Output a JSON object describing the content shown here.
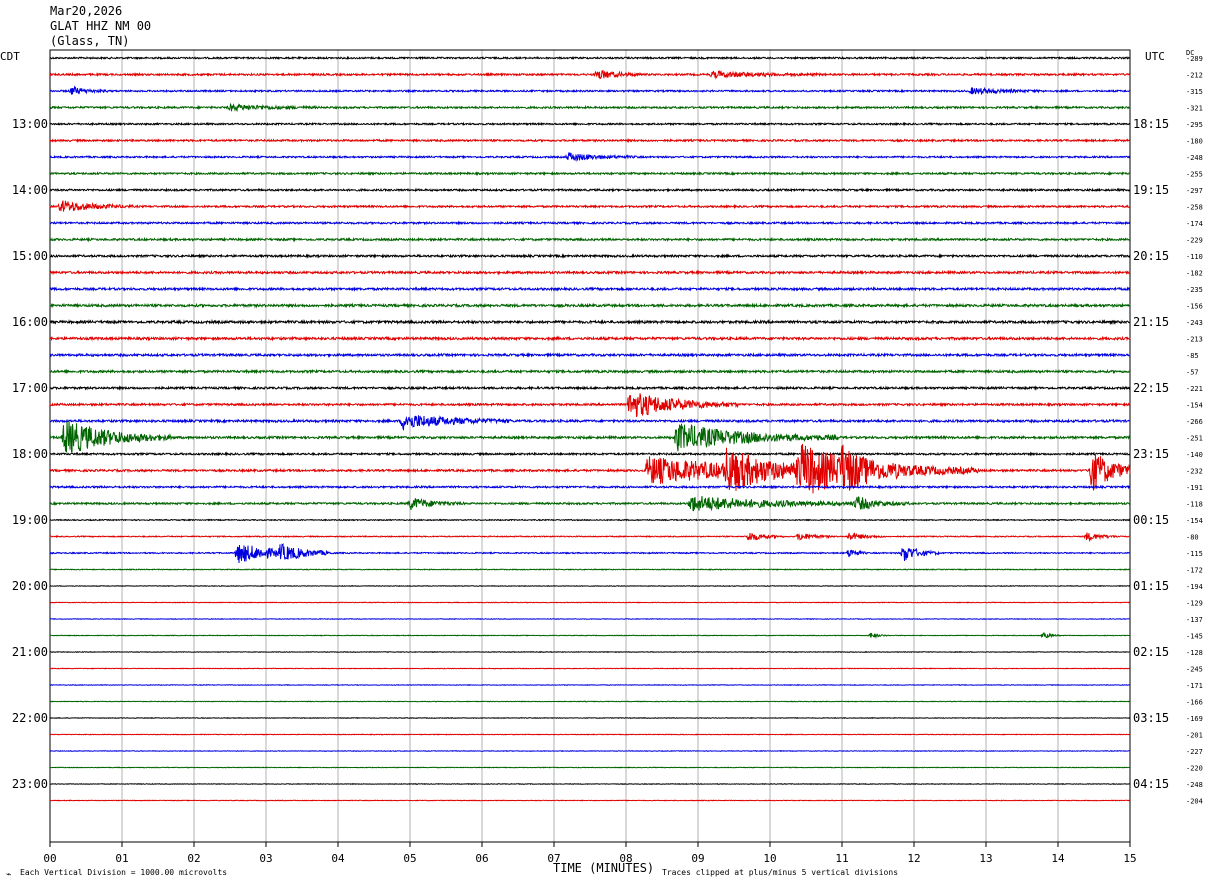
{
  "header": {
    "date": "Mar20,2026",
    "station": "GLAT HHZ NM 00",
    "location": "(Glass, TN)"
  },
  "left_axis_label": "CDT",
  "right_axis_label": "UTC",
  "dc_label": "DC",
  "footer": {
    "scale_note": "Each Vertical Division = 1000.00 microvolts",
    "xlabel": "TIME (MINUTES)",
    "clip_note": "Traces clipped at plus/minus 5 vertical divisions"
  },
  "colors": {
    "cycle": [
      "#000000",
      "#e00000",
      "#0000e0",
      "#006400"
    ],
    "grid": "#808080"
  },
  "chart_data": {
    "type": "line",
    "title": "GLAT HHZ NM 00",
    "xlabel": "TIME (MINUTES)",
    "xlim": [
      0,
      15
    ],
    "x_ticks": [
      "00",
      "01",
      "02",
      "03",
      "04",
      "05",
      "06",
      "07",
      "08",
      "09",
      "10",
      "11",
      "12",
      "13",
      "14",
      "15"
    ],
    "cdt_hour_labels": [
      "13:00",
      "14:00",
      "15:00",
      "16:00",
      "17:00",
      "18:00",
      "19:00",
      "20:00",
      "21:00",
      "22:00",
      "23:00"
    ],
    "utc_hour_labels": [
      "18:15",
      "19:15",
      "20:15",
      "21:15",
      "22:15",
      "23:15",
      "00:15",
      "01:15",
      "02:15",
      "03:15",
      "04:15"
    ],
    "trace_dc_offsets": [
      -289,
      -212,
      -315,
      -321,
      -295,
      -180,
      -248,
      -255,
      -297,
      -258,
      -174,
      -229,
      -110,
      -182,
      -235,
      -156,
      -243,
      -213,
      -85,
      -57,
      -221,
      -154,
      -266,
      -251,
      -140,
      -232,
      -191,
      -118,
      -154,
      -80,
      -115,
      -172,
      -194,
      -129,
      -137,
      -145,
      -128,
      -245,
      -171,
      -166,
      -169,
      -201,
      -227,
      -220,
      -248,
      -204
    ],
    "trace_noise_level": [
      0.8,
      0.9,
      0.8,
      0.9,
      0.8,
      0.9,
      0.8,
      0.9,
      0.9,
      0.9,
      0.9,
      1.0,
      1.0,
      1.1,
      1.1,
      1.2,
      1.2,
      1.2,
      1.1,
      1.1,
      1.0,
      1.0,
      1.1,
      1.1,
      0.9,
      1.0,
      0.9,
      0.9,
      0.5,
      0.5,
      0.6,
      0.4,
      0.3,
      0.3,
      0.3,
      0.3,
      0.3,
      0.3,
      0.3,
      0.3,
      0.3,
      0.3,
      0.3,
      0.3,
      0.3,
      0.3
    ],
    "events": [
      {
        "trace": 1,
        "minute": 7.6,
        "amp": 5.0,
        "dur": 0.25
      },
      {
        "trace": 1,
        "minute": 9.2,
        "amp": 3.0,
        "dur": 0.6
      },
      {
        "trace": 2,
        "minute": 0.3,
        "amp": 4.0,
        "dur": 0.2
      },
      {
        "trace": 2,
        "minute": 12.8,
        "amp": 3.0,
        "dur": 0.4
      },
      {
        "trace": 3,
        "minute": 2.5,
        "amp": 3.0,
        "dur": 0.5
      },
      {
        "trace": 6,
        "minute": 7.2,
        "amp": 4.0,
        "dur": 0.4
      },
      {
        "trace": 9,
        "minute": 0.15,
        "amp": 6.0,
        "dur": 0.4
      },
      {
        "trace": 21,
        "minute": 8.05,
        "amp": 14.0,
        "dur": 0.6
      },
      {
        "trace": 22,
        "minute": 4.9,
        "amp": 8.0,
        "dur": 0.6
      },
      {
        "trace": 23,
        "minute": 0.2,
        "amp": 18.0,
        "dur": 0.6
      },
      {
        "trace": 23,
        "minute": 8.7,
        "amp": 14.0,
        "dur": 0.9
      },
      {
        "trace": 25,
        "minute": 8.3,
        "amp": 14.0,
        "dur": 1.4
      },
      {
        "trace": 25,
        "minute": 9.4,
        "amp": 18.0,
        "dur": 0.5
      },
      {
        "trace": 25,
        "minute": 10.4,
        "amp": 22.0,
        "dur": 1.0
      },
      {
        "trace": 25,
        "minute": 11.0,
        "amp": 14.0,
        "dur": 0.2
      },
      {
        "trace": 25,
        "minute": 14.45,
        "amp": 22.0,
        "dur": 0.3
      },
      {
        "trace": 27,
        "minute": 5.0,
        "amp": 6.0,
        "dur": 0.3
      },
      {
        "trace": 27,
        "minute": 8.9,
        "amp": 8.0,
        "dur": 1.0
      },
      {
        "trace": 27,
        "minute": 11.2,
        "amp": 6.0,
        "dur": 0.3
      },
      {
        "trace": 29,
        "minute": 9.7,
        "amp": 5.0,
        "dur": 0.2
      },
      {
        "trace": 29,
        "minute": 10.4,
        "amp": 4.0,
        "dur": 0.2
      },
      {
        "trace": 29,
        "minute": 11.1,
        "amp": 4.0,
        "dur": 0.2
      },
      {
        "trace": 29,
        "minute": 14.4,
        "amp": 4.0,
        "dur": 0.2
      },
      {
        "trace": 30,
        "minute": 2.6,
        "amp": 10.0,
        "dur": 0.5
      },
      {
        "trace": 30,
        "minute": 3.2,
        "amp": 6.0,
        "dur": 0.3
      },
      {
        "trace": 30,
        "minute": 11.1,
        "amp": 5.0,
        "dur": 0.1
      },
      {
        "trace": 30,
        "minute": 11.85,
        "amp": 9.0,
        "dur": 0.2
      },
      {
        "trace": 35,
        "minute": 11.4,
        "amp": 3.0,
        "dur": 0.1
      },
      {
        "trace": 35,
        "minute": 13.8,
        "amp": 3.0,
        "dur": 0.1
      }
    ]
  }
}
